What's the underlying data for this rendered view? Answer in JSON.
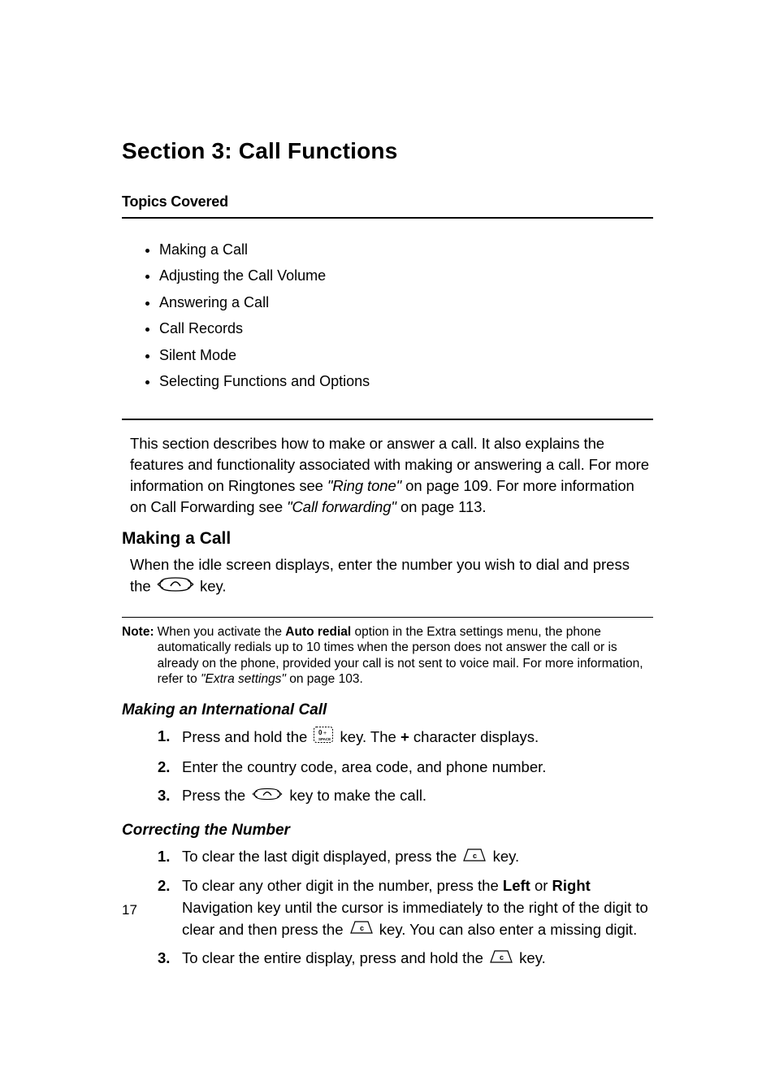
{
  "section_title": "Section 3: Call Functions",
  "topics_heading": "Topics Covered",
  "topics": [
    "Making a Call",
    "Adjusting the Call Volume",
    "Answering a Call",
    "Call Records",
    "Silent Mode",
    "Selecting Functions and Options"
  ],
  "intro": {
    "text_part1": "This section describes how to make or answer a call. It also explains the features and functionality associated with making or answering a call. For more information on Ringtones see ",
    "ref1_italic": "\"Ring tone\" ",
    "ref1_tail": " on page 109. For more information on Call Forwarding see ",
    "ref2_italic": "\"Call forwarding\" ",
    "ref2_tail": " on page 113."
  },
  "making_call": {
    "heading": "Making a Call",
    "body_a": "When the idle screen displays, enter the number you wish to dial and press the ",
    "body_b": " key."
  },
  "note": {
    "label": "Note: ",
    "part1": "When you activate the ",
    "auto_redial": "Auto redial",
    "part2": " option in the Extra settings menu, the phone automatically redials up to 10 times when the person does not answer the call or is already on the phone, provided your call is not sent to voice mail. For more information, refer to ",
    "ref_italic": "\"Extra settings\" ",
    "ref_tail": " on page 103."
  },
  "intl_call": {
    "heading": "Making an International Call",
    "step1a": "Press and hold the ",
    "step1b": " key. The ",
    "step1_plus": "+",
    "step1c": " character displays.",
    "step2": "Enter the country code, area code, and phone number.",
    "step3a": "Press the ",
    "step3b": " key to make the call."
  },
  "correct_number": {
    "heading": "Correcting the Number",
    "step1a": "To clear the last digit displayed, press the ",
    "step1b": " key.",
    "step2a": "To clear any other digit in the number, press the ",
    "left": "Left",
    "or": " or ",
    "right": "Right",
    "step2b": " Navigation key until the cursor is immediately to the right of the digit to clear and then press the ",
    "step2c": " key. You can also enter a missing digit.",
    "step3a": "To clear the entire display, press and hold the ",
    "step3b": " key."
  },
  "page_number": "17"
}
